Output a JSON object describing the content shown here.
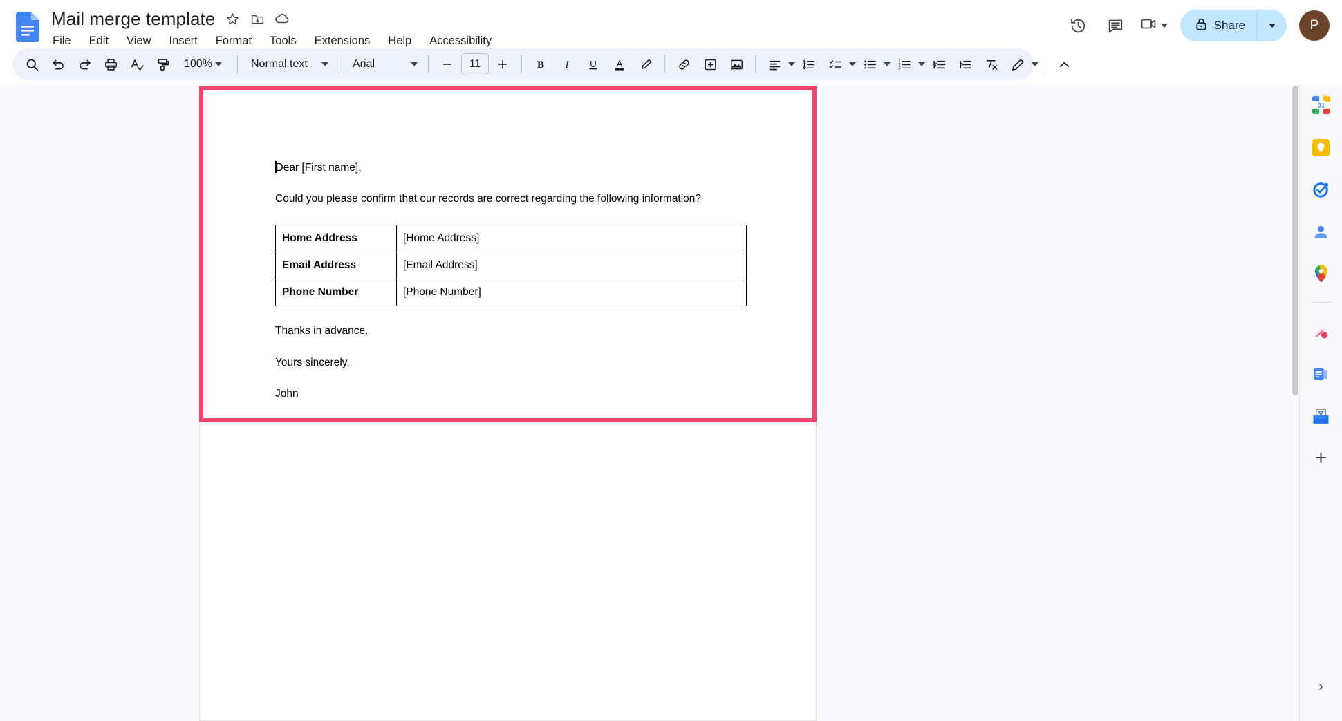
{
  "header": {
    "doc_title": "Mail merge template",
    "logo_name": "google-docs-logo",
    "title_icons": [
      {
        "name": "star-icon",
        "label": "Star"
      },
      {
        "name": "move-to-folder-icon",
        "label": "Move"
      },
      {
        "name": "cloud-saved-icon",
        "label": "Saved to Drive"
      }
    ],
    "menus": [
      "File",
      "Edit",
      "View",
      "Insert",
      "Format",
      "Tools",
      "Extensions",
      "Help",
      "Accessibility"
    ],
    "actions": {
      "history_icon": "version-history-icon",
      "comment_icon": "comment-history-icon",
      "meet_icon": "google-meet-icon",
      "share_label": "Share",
      "share_lock_icon": "lock-icon",
      "avatar_initial": "P",
      "avatar_color": "#6b4328",
      "share_bg": "#c2e7ff"
    }
  },
  "toolbar": {
    "search": "search-icon",
    "undo": "undo-icon",
    "redo": "redo-icon",
    "print": "print-icon",
    "spellcheck": "spellcheck-icon",
    "paint_format": "paint-format-icon",
    "zoom_value": "100%",
    "style_value": "Normal text",
    "font_value": "Arial",
    "font_size_value": "11",
    "decrease_font": "minus-icon",
    "increase_font": "plus-icon",
    "bold": "B",
    "italic": "I",
    "underline": "U",
    "text_color": "A",
    "highlight": "highlight-pen-icon",
    "insert_link": "link-icon",
    "add_comment": "add-comment-icon",
    "insert_image": "insert-image-icon",
    "align": "align-left-icon",
    "line_spacing": "line-spacing-icon",
    "checklist": "checklist-icon",
    "bulleted_list": "bulleted-list-icon",
    "numbered_list": "numbered-list-icon",
    "decrease_indent": "decrease-indent-icon",
    "increase_indent": "increase-indent-icon",
    "clear_formatting": "clear-formatting-icon",
    "editing_mode": "editing-pencil-icon",
    "collapse": "collapse-toolbar-icon"
  },
  "document": {
    "highlight_color": "#f3436b",
    "salutation": "Dear [First name],",
    "intro": "Could you please confirm that our records are correct regarding the following information?",
    "table": {
      "rows": [
        {
          "label": "Home Address",
          "value": "[Home Address]"
        },
        {
          "label": "Email Address",
          "value": "[Email Address]"
        },
        {
          "label": "Phone Number",
          "value": "[Phone Number]"
        }
      ]
    },
    "thanks": "Thanks in advance.",
    "signoff": "Yours sincerely,",
    "sender": "John"
  },
  "side_panel": {
    "items": [
      {
        "name": "google-calendar-icon",
        "label": "Calendar",
        "badge": "31"
      },
      {
        "name": "google-keep-icon",
        "label": "Keep"
      },
      {
        "name": "google-tasks-icon",
        "label": "Tasks"
      },
      {
        "name": "google-contacts-icon",
        "label": "Contacts"
      },
      {
        "name": "google-maps-icon",
        "label": "Maps"
      }
    ],
    "addons": [
      {
        "name": "addon-comet-icon",
        "label": "Add-on"
      },
      {
        "name": "addon-docs-blue-icon",
        "label": "Add-on"
      },
      {
        "name": "addon-mail-merge-icon",
        "label": "Add-on"
      }
    ],
    "add_label": "+",
    "expand_label": "›"
  }
}
